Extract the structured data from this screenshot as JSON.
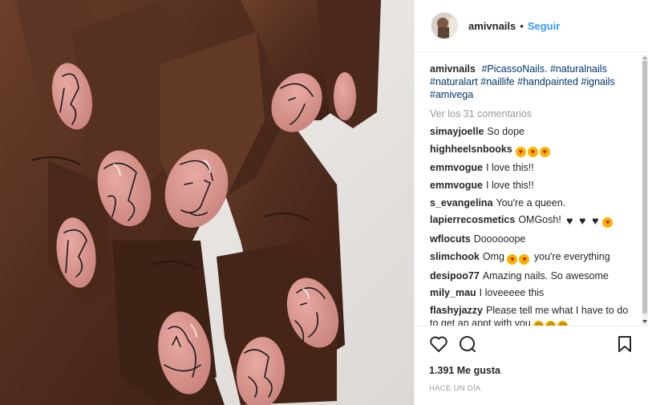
{
  "header": {
    "username": "amivnails",
    "separator": "•",
    "follow_label": "Seguir"
  },
  "caption": {
    "user": "amivnails",
    "tags": [
      "#PicassoNails.",
      "#naturalnails",
      "#naturalart",
      "#naillife",
      "#handpainted",
      "#ignails",
      "#amivega"
    ]
  },
  "view_more": "Ver los 31 comentarios",
  "comments": [
    {
      "user": "simayjoelle",
      "text": "So dope",
      "emojis": []
    },
    {
      "user": "highheelsnbooks",
      "text": "",
      "emojis": [
        "heart-eyes-emoji",
        "heart-eyes-emoji",
        "heart-eyes-emoji"
      ]
    },
    {
      "user": "emmvogue",
      "text": "I love this!!",
      "emojis": []
    },
    {
      "user": "emmvogue",
      "text": "I love this!!",
      "emojis": []
    },
    {
      "user": "s_evangelina",
      "text": "You're a queen.",
      "emojis": []
    },
    {
      "user": "lapierrecosmetics",
      "text": "OMGosh!",
      "emojis": [
        "black-heart-emoji",
        "black-heart-emoji",
        "black-heart-emoji",
        "heart-eyes-emoji"
      ]
    },
    {
      "user": "wflocuts",
      "text": "Doooooope",
      "emojis": []
    },
    {
      "user": "slimchook",
      "text": "Omg",
      "emojis": [
        "heart-eyes-emoji",
        "heart-eyes-emoji"
      ],
      "text_after": "you're everything"
    },
    {
      "user": "desipoo77",
      "text": "Amazing nails. So awesome",
      "emojis": []
    },
    {
      "user": "mily_mau",
      "text": "I loveeeee this",
      "emojis": []
    },
    {
      "user": "flashyjazzy",
      "text": "Please tell me what I have to do to get an appt with you",
      "emojis": [
        "sad-face-emoji",
        "sad-face-emoji",
        "sad-face-emoji"
      ]
    }
  ],
  "actions": {
    "like_icon": "heart-outline-icon",
    "comment_icon": "comment-bubble-icon",
    "save_icon": "bookmark-icon"
  },
  "likes": "1.391 Me gusta",
  "time": "HACE UN DÍA",
  "colors": {
    "link": "#3897f0",
    "hashtag": "#003569",
    "muted": "#999999",
    "text": "#262626",
    "nail_pink": "#d9968f",
    "skin": "#5a3424"
  }
}
